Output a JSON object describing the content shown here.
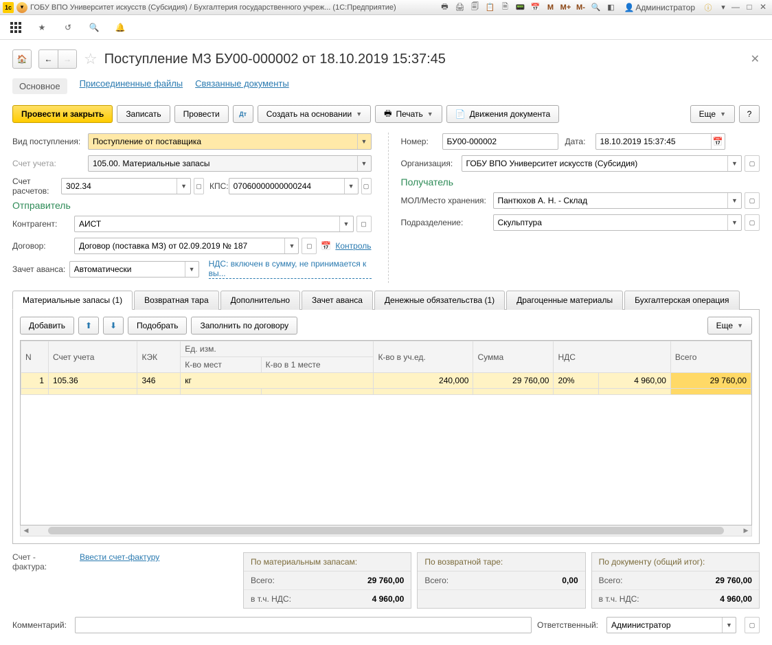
{
  "titlebar": {
    "title": "ГОБУ ВПО Университет искусств (Субсидия) / Бухгалтерия государственного учреж...  (1С:Предприятие)",
    "user": "Администратор"
  },
  "header": {
    "title": "Поступление МЗ БУ00-000002 от 18.10.2019 15:37:45"
  },
  "subtabs": {
    "main": "Основное",
    "files": "Присоединенные файлы",
    "linked": "Связанные документы"
  },
  "toolbar": {
    "post_close": "Провести и закрыть",
    "save": "Записать",
    "post": "Провести",
    "create_on": "Создать на основании",
    "print": "Печать",
    "moves": "Движения документа",
    "more": "Еще"
  },
  "fields": {
    "vid_lbl": "Вид поступления:",
    "vid": "Поступление от поставщика",
    "schet_ucheta_lbl": "Счет учета:",
    "schet_ucheta": "105.00. Материальные запасы",
    "schet_rasch_lbl": "Счет расчетов:",
    "schet_rasch": "302.34",
    "kps_lbl": "КПС:",
    "kps": "07060000000000244",
    "otprav": "Отправитель",
    "kontragent_lbl": "Контрагент:",
    "kontragent": "АИСТ",
    "dogovor_lbl": "Договор:",
    "dogovor": "Договор (поставка МЗ) от 02.09.2019 № 187",
    "kontrol": "Контроль",
    "zachet_lbl": "Зачет аванса:",
    "zachet": "Автоматически",
    "nds_link": "НДС: включен в сумму, не принимается к вы...",
    "nomer_lbl": "Номер:",
    "nomer": "БУ00-000002",
    "data_lbl": "Дата:",
    "data": "18.10.2019 15:37:45",
    "org_lbl": "Организация:",
    "org": "ГОБУ ВПО Университет искусств (Субсидия)",
    "poluch": "Получатель",
    "mol_lbl": "МОЛ/Место хранения:",
    "mol": "Пантюхов А. Н. - Склад",
    "podr_lbl": "Подразделение:",
    "podr": "Скульптура"
  },
  "tabs": {
    "t1": "Материальные запасы (1)",
    "t2": "Возвратная тара",
    "t3": "Дополнительно",
    "t4": "Зачет аванса",
    "t5": "Денежные обязательства (1)",
    "t6": "Драгоценные материалы",
    "t7": "Бухгалтерская операция"
  },
  "tabtools": {
    "add": "Добавить",
    "pick": "Подобрать",
    "fill": "Заполнить по договору",
    "more": "Еще"
  },
  "grid": {
    "h_n": "N",
    "h_schet": "Счет учета",
    "h_kek": "КЭК",
    "h_ed": "Ед. изм.",
    "h_mest": "К-во мест",
    "h_v1": "К-во в 1 месте",
    "h_kvo": "К-во в уч.ед.",
    "h_summa": "Сумма",
    "h_nds": "НДС",
    "h_vsego": "Всего",
    "r1_n": "1",
    "r1_schet": "105.36",
    "r1_kek": "346",
    "r1_ed": "кг",
    "r1_kvo": "240,000",
    "r1_summa": "29 760,00",
    "r1_nds": "20%",
    "r1_nds_sum": "4 960,00",
    "r1_vsego": "29 760,00"
  },
  "invoice": {
    "lbl": "Счет - фактура:",
    "link": "Ввести счет-фактуру"
  },
  "totals": {
    "mat_h": "По материальным запасам:",
    "tara_h": "По возвратной таре:",
    "doc_h": "По документу (общий итог):",
    "vsego": "Всего:",
    "nds": "в т.ч. НДС:",
    "mat_vsego": "29 760,00",
    "mat_nds": "4 960,00",
    "tara_vsego": "0,00",
    "doc_vsego": "29 760,00",
    "doc_nds": "4 960,00"
  },
  "footer": {
    "comment_lbl": "Комментарий:",
    "resp_lbl": "Ответственный:",
    "resp": "Администратор"
  }
}
